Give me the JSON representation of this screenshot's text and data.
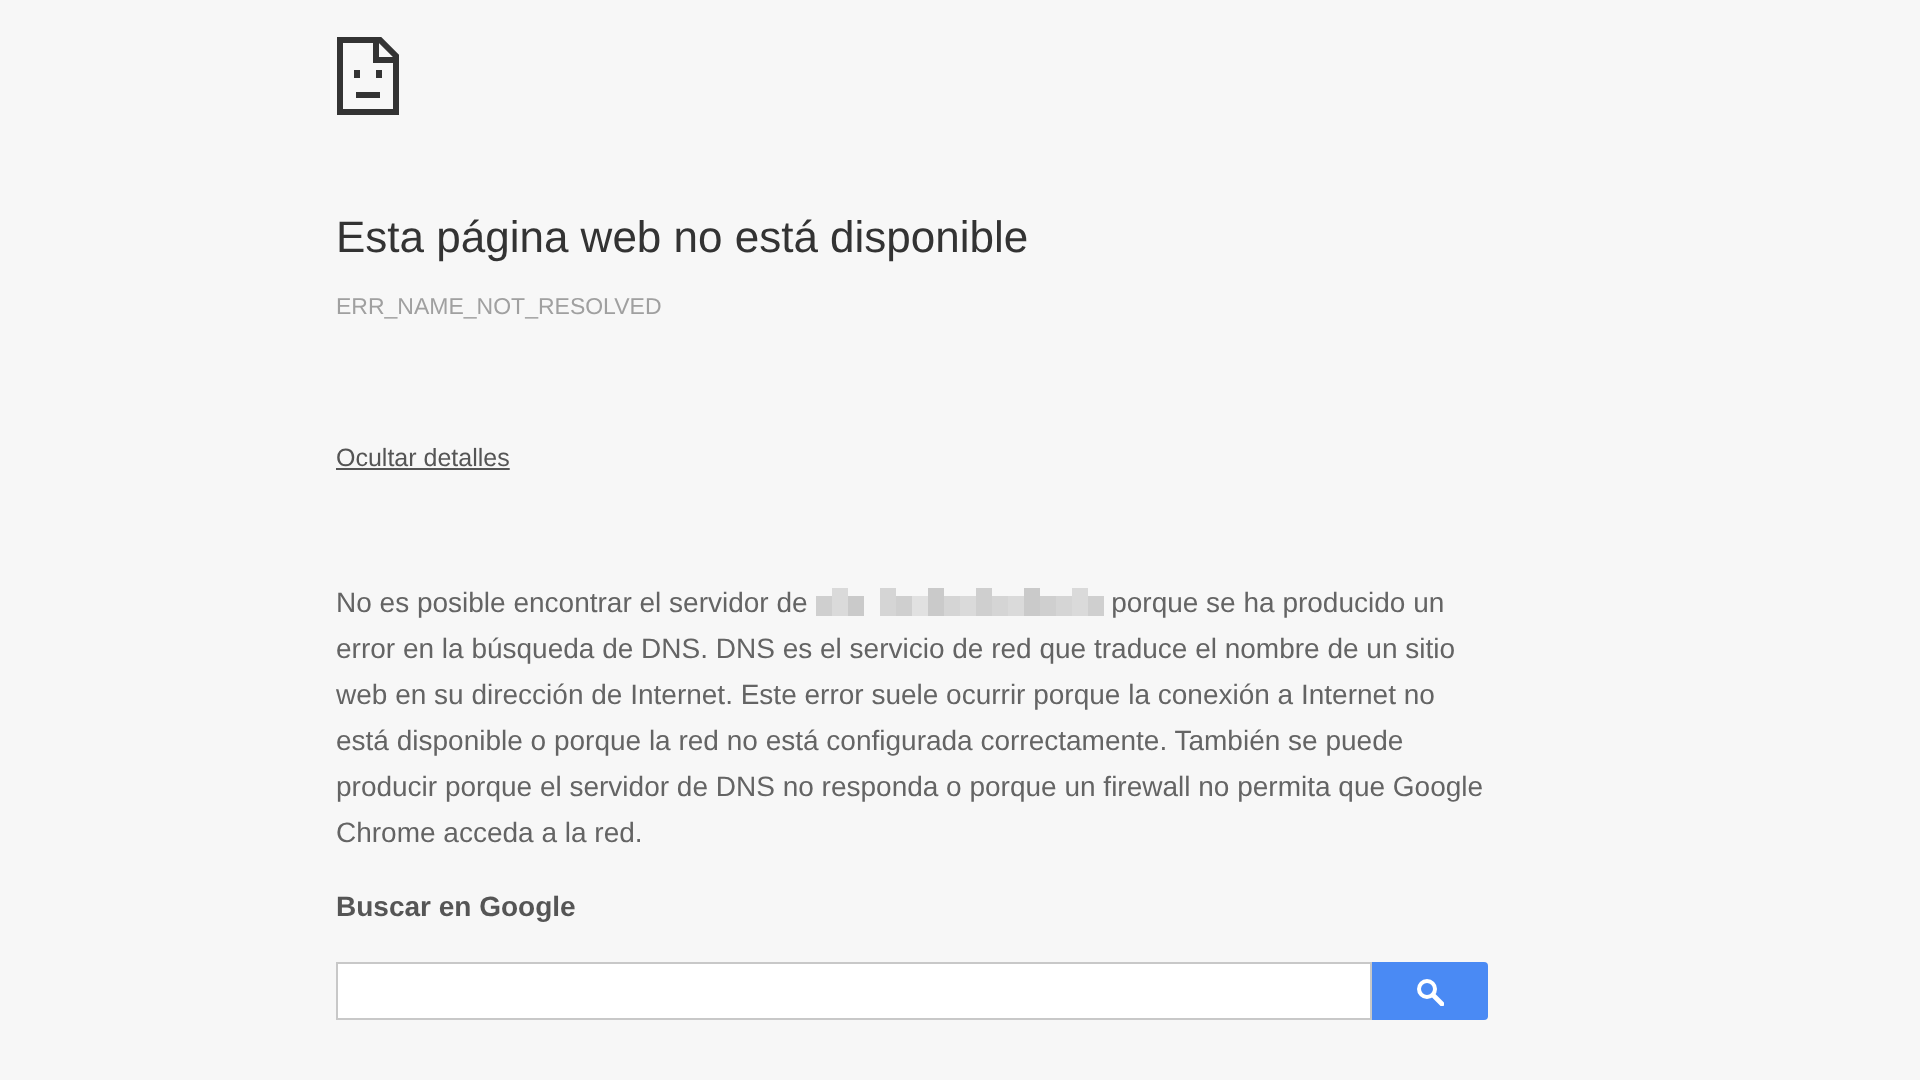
{
  "title": "Esta página web no está disponible",
  "error_code": "ERR_NAME_NOT_RESOLVED",
  "details_link": "Ocultar detalles",
  "description": {
    "before": "No es posible encontrar el servidor de",
    "after_first_line": "porque se ha producido un",
    "rest": "error en la búsqueda de DNS. DNS es el servicio de red que traduce el nombre de un sitio web en su dirección de Internet. Este error suele ocurrir porque la conexión a Internet no está disponible o porque la red no está configurada correctamente. También se puede producir porque el servidor de DNS no responda o porque un firewall no permita que Google Chrome acceda a la red."
  },
  "search": {
    "heading": "Buscar en Google"
  }
}
